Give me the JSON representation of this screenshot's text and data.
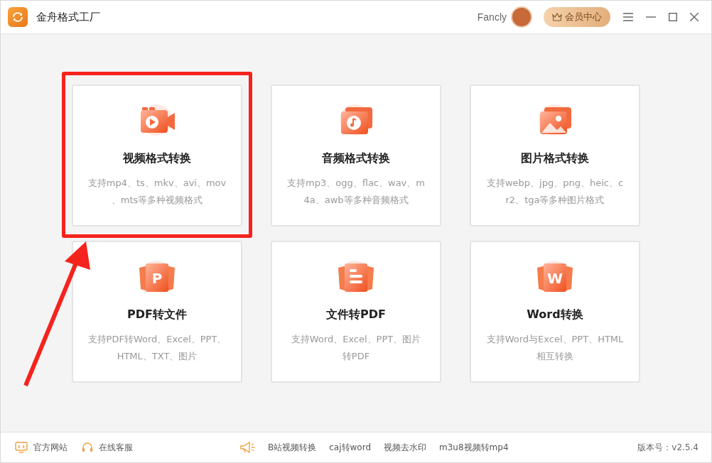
{
  "window": {
    "title": "金舟格式工厂"
  },
  "user": {
    "name": "Fancly"
  },
  "vip_button": {
    "label": "会员中心"
  },
  "cards": [
    {
      "kind": "video",
      "title": "视频格式转换",
      "desc_lines": [
        "支持mp4、ts、mkv、avi、mov",
        "、mts等多种视频格式"
      ],
      "highlighted": true
    },
    {
      "kind": "audio",
      "title": "音频格式转换",
      "desc_lines": [
        "支持mp3、ogg、flac、wav、m",
        "4a、awb等多种音频格式"
      ],
      "highlighted": false
    },
    {
      "kind": "image",
      "title": "图片格式转换",
      "desc_lines": [
        "支持webp、jpg、png、heic、c",
        "r2、tga等多种图片格式"
      ],
      "highlighted": false
    },
    {
      "kind": "pdf",
      "icon_letter": "P",
      "title": "PDF转文件",
      "desc_lines": [
        "支持PDF转Word、Excel、PPT、",
        "HTML、TXT、图片"
      ],
      "highlighted": false
    },
    {
      "kind": "doc",
      "title": "文件转PDF",
      "desc_lines": [
        "支持Word、Excel、PPT、图片",
        "转PDF"
      ],
      "highlighted": false
    },
    {
      "kind": "word",
      "icon_letter": "W",
      "title": "Word转换",
      "desc_lines": [
        "支持Word与Excel、PPT、HTML",
        "相互转换"
      ],
      "highlighted": false
    }
  ],
  "footer": {
    "left_links": [
      {
        "kind": "monitor",
        "label": "官方网站"
      },
      {
        "kind": "headset",
        "label": "在线客服"
      }
    ],
    "quick_links": [
      "B站视频转换",
      "caj转word",
      "视频去水印",
      "m3u8视频转mp4"
    ],
    "version": "版本号：v2.5.4"
  }
}
